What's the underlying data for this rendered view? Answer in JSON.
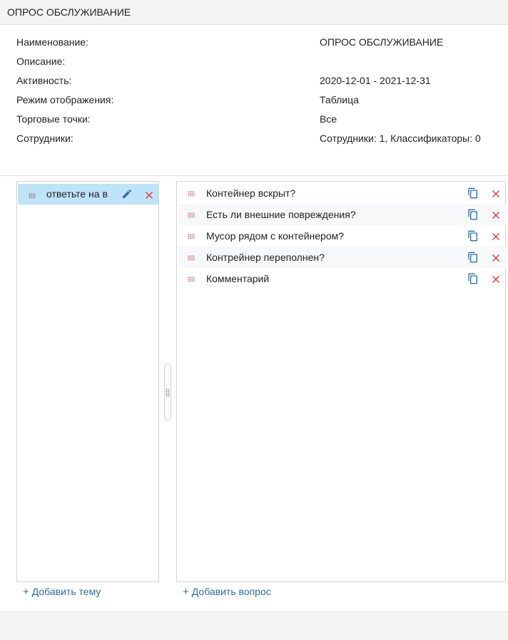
{
  "window": {
    "title": "ОПРОС ОБСЛУЖИВАНИЕ"
  },
  "props": [
    {
      "label": "Наименование:",
      "value": "ОПРОС ОБСЛУЖИВАНИЕ"
    },
    {
      "label": "Описание:",
      "value": ""
    },
    {
      "label": "Активность:",
      "value": "2020-12-01 - 2021-12-31"
    },
    {
      "label": "Режим отображения:",
      "value": "Таблица"
    },
    {
      "label": "Торговые точки:",
      "value": "Все"
    },
    {
      "label": "Сотрудники:",
      "value": "Сотрудники: 1, Классификаторы: 0"
    }
  ],
  "themes": [
    {
      "label": "ответьте на вопросы"
    }
  ],
  "questions": [
    {
      "label": "Контейнер вскрыт?"
    },
    {
      "label": "Есть ли внешние повреждения?"
    },
    {
      "label": "Мусор рядом с контейнером?"
    },
    {
      "label": "Контрейнер переполнен?"
    },
    {
      "label": "Комментарий"
    }
  ],
  "actions": {
    "add_theme": "Добавить тему",
    "add_question": "Добавить вопрос",
    "plus": "+"
  },
  "colors": {
    "accent": "#2f6ea8",
    "selected": "#bfe3f9",
    "delete": "#e53935",
    "copy": "#2f6ea8"
  }
}
